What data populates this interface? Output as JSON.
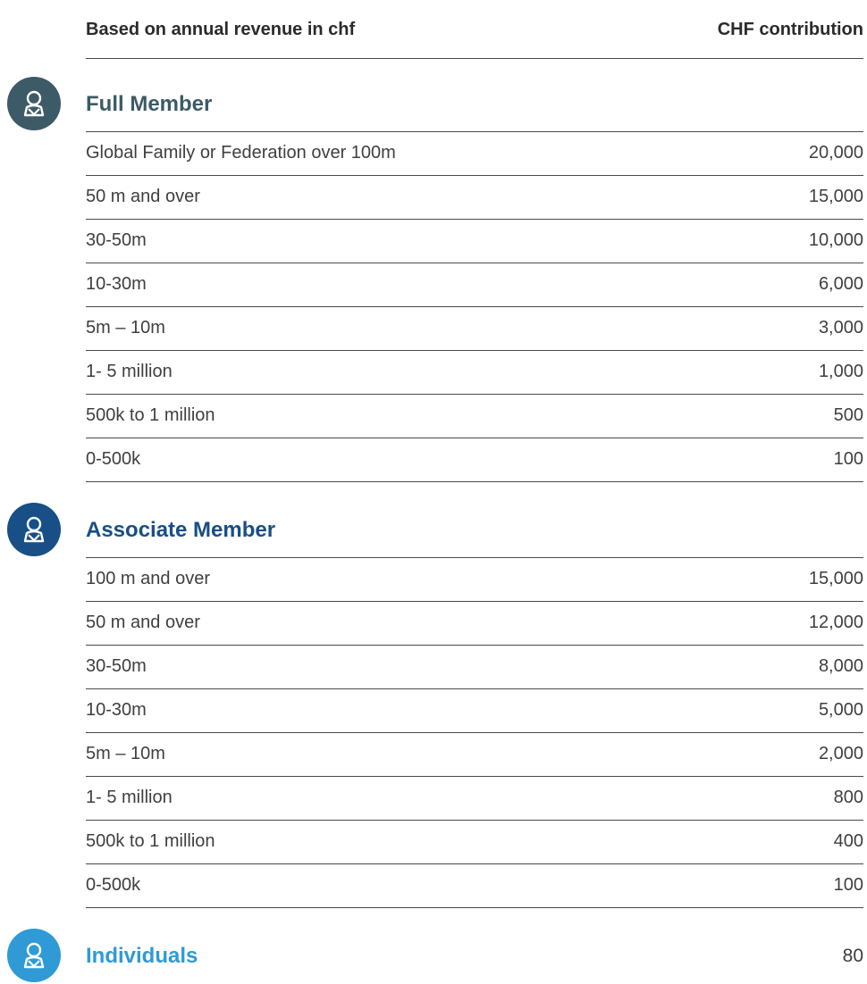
{
  "header": {
    "left_label": "Based on annual revenue in chf",
    "right_label": "CHF contribution"
  },
  "sections": {
    "full": {
      "title": "Full Member",
      "icon": "user-icon",
      "color": "#3d5a67",
      "rows": [
        {
          "label": "Global Family or Federation over 100m",
          "amount": "20,000"
        },
        {
          "label": "50 m and over",
          "amount": "15,000"
        },
        {
          "label": "30-50m",
          "amount": "10,000"
        },
        {
          "label": "10-30m",
          "amount": "6,000"
        },
        {
          "label": "5m – 10m",
          "amount": "3,000"
        },
        {
          "label": "1- 5 million",
          "amount": "1,000"
        },
        {
          "label": "500k to 1 million",
          "amount": "500"
        },
        {
          "label": "0-500k",
          "amount": "100"
        }
      ]
    },
    "associate": {
      "title": "Associate Member",
      "icon": "user-icon",
      "color": "#174f86",
      "rows": [
        {
          "label": "100 m and over",
          "amount": "15,000"
        },
        {
          "label": "50 m and over",
          "amount": "12,000"
        },
        {
          "label": "30-50m",
          "amount": "8,000"
        },
        {
          "label": "10-30m",
          "amount": "5,000"
        },
        {
          "label": "5m – 10m",
          "amount": "2,000"
        },
        {
          "label": "1- 5 million",
          "amount": "800"
        },
        {
          "label": "500k to 1 million",
          "amount": "400"
        },
        {
          "label": "0-500k",
          "amount": "100"
        }
      ]
    },
    "individuals": {
      "title": "Individuals",
      "icon": "user-icon",
      "color": "#2f9ad6",
      "value": "80"
    }
  }
}
